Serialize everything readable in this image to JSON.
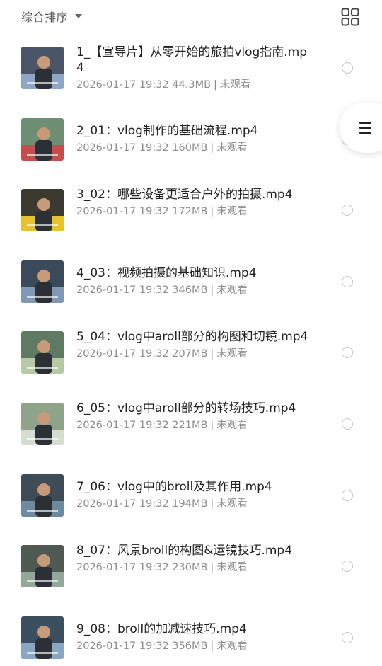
{
  "header": {
    "sort_label": "综合排序",
    "caret_icon": "caret-down-icon",
    "grid_icon": "grid-view-icon"
  },
  "float_menu": {
    "icon": "menu-icon"
  },
  "items": [
    {
      "title": "1_【宣导片】从零开始的旅拍vlog指南.mp4",
      "date": "2026-01-17 19:32",
      "size": "44.3MB",
      "status": "未观看",
      "bg": "#4a5568",
      "accent": "#8ea6c8"
    },
    {
      "title": "2_01：vlog制作的基础流程.mp4",
      "date": "2026-01-17 19:32",
      "size": "160MB",
      "status": "未观看",
      "bg": "#6e8f73",
      "accent": "#c44d4d"
    },
    {
      "title": "3_02：哪些设备更适合户外的拍摄.mp4",
      "date": "2026-01-17 19:32",
      "size": "172MB",
      "status": "未观看",
      "bg": "#3a3a30",
      "accent": "#e6c230"
    },
    {
      "title": "4_03：视频拍摄的基础知识.mp4",
      "date": "2026-01-17 19:32",
      "size": "346MB",
      "status": "未观看",
      "bg": "#3b4a5a",
      "accent": "#7f98b5"
    },
    {
      "title": "5_04：vlog中aroll部分的构图和切镜.mp4",
      "date": "2026-01-17 19:32",
      "size": "207MB",
      "status": "未观看",
      "bg": "#5f7a63",
      "accent": "#b7c9a5"
    },
    {
      "title": "6_05：vlog中aroll部分的转场技巧.mp4",
      "date": "2026-01-17 19:32",
      "size": "221MB",
      "status": "未观看",
      "bg": "#8fa28a",
      "accent": "#d6ddd0"
    },
    {
      "title": "7_06：vlog中的broll及其作用.mp4",
      "date": "2026-01-17 19:32",
      "size": "194MB",
      "status": "未观看",
      "bg": "#3f4b56",
      "accent": "#6e8aa0"
    },
    {
      "title": "8_07：风景broll的构图&运镜技巧.mp4",
      "date": "2026-01-17 19:32",
      "size": "230MB",
      "status": "未观看",
      "bg": "#4e5a52",
      "accent": "#93a79a"
    },
    {
      "title": "9_08：broll的加减速技巧.mp4",
      "date": "2026-01-17 19:32",
      "size": "356MB",
      "status": "未观看",
      "bg": "#3c4f60",
      "accent": "#89a7c0"
    }
  ]
}
